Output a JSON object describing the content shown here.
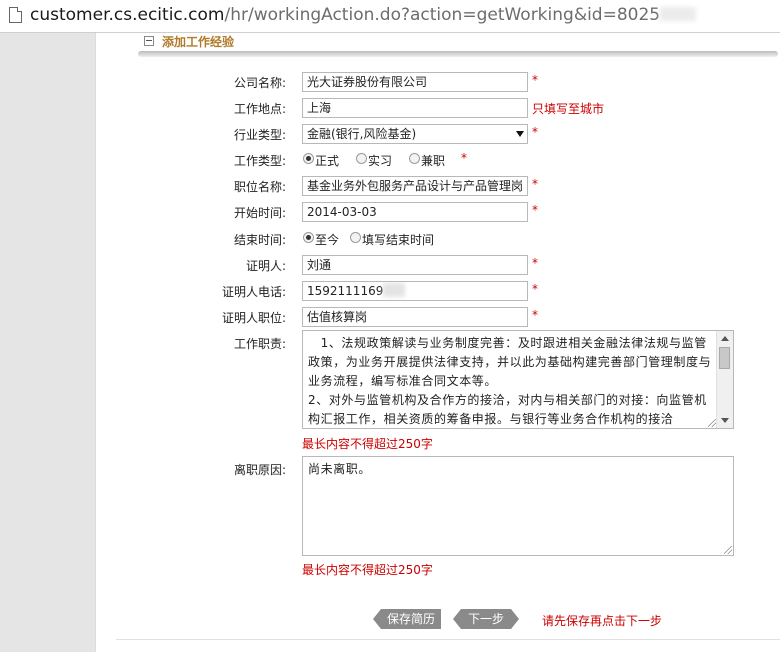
{
  "browser": {
    "url_host": "customer.cs.ecitic.com",
    "url_path": "/hr/workingAction.do?action=getWorking&id=8025"
  },
  "section": {
    "title": "添加工作经验"
  },
  "form": {
    "company": {
      "label": "公司名称:",
      "value": "光大证券股份有限公司",
      "required": "*"
    },
    "location": {
      "label": "工作地点:",
      "value": "上海",
      "hint": "只填写至城市"
    },
    "industry": {
      "label": "行业类型:",
      "value": "金融(银行,风险基金)",
      "required": "*"
    },
    "job_type": {
      "label": "工作类型:",
      "options": [
        "正式",
        "实习",
        "兼职"
      ],
      "selected": "正式",
      "required": "*"
    },
    "position": {
      "label": "职位名称:",
      "value": "基金业务外包服务产品设计与产品管理岗",
      "required": "*"
    },
    "start": {
      "label": "开始时间:",
      "value": "2014-03-03",
      "required": "*"
    },
    "end": {
      "label": "结束时间:",
      "options": [
        "至今",
        "填写结束时间"
      ],
      "selected": "至今"
    },
    "reference": {
      "label": "证明人:",
      "value": "刘通",
      "required": "*"
    },
    "reference_phone": {
      "label": "证明人电话:",
      "value": "1592111169",
      "required": "*"
    },
    "reference_title": {
      "label": "证明人职位:",
      "value": "估值核算岗",
      "required": "*"
    },
    "duties": {
      "label": "工作职责:",
      "value": "　1、法规政策解读与业务制度完善：及时跟进相关金融法律法规与监管政策，为业务开展提供法律支持，并以此为基础构建完善部门管理制度与业务流程，编写标准合同文本等。\n2、对外与监管机构及合作方的接洽，对内与相关部门的对接：向监管机构汇报工作，相关资质的筹备申报。与银行等业务合作机构的接洽",
      "limit_note": "最长内容不得超过250字"
    },
    "leave_reason": {
      "label": "离职原因:",
      "value": "尚未离职。",
      "limit_note": "最长内容不得超过250字"
    }
  },
  "actions": {
    "save_label": "保存简历",
    "next_label": "下一步",
    "note": "请先保存再点击下一步"
  },
  "colors": {
    "required": "#cc0000",
    "section_title": "#b07b2a",
    "button": "#8a8a8a"
  }
}
